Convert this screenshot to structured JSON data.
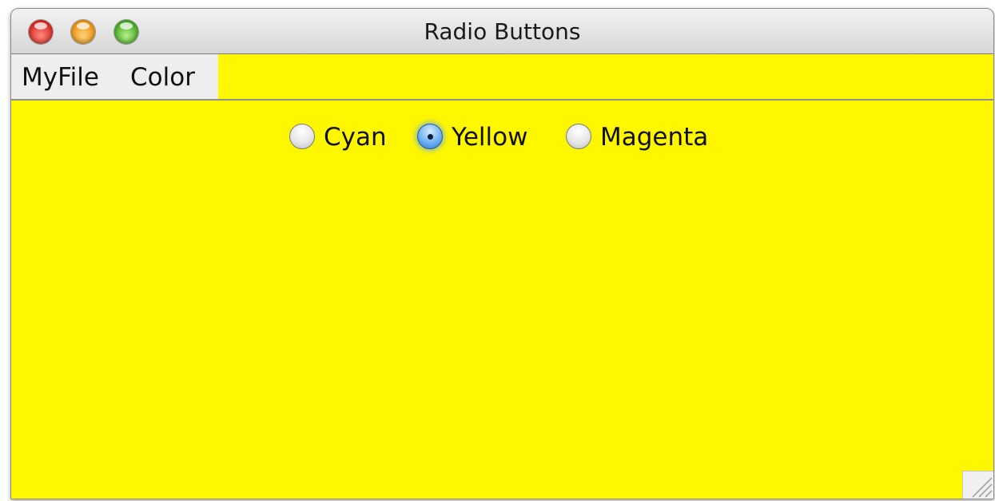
{
  "window": {
    "title": "Radio Buttons",
    "background_color": "#fff700"
  },
  "titlebar_buttons": [
    "close",
    "minimize",
    "zoom"
  ],
  "menubar": {
    "items": [
      {
        "label": "MyFile"
      },
      {
        "label": "Color"
      }
    ]
  },
  "radio_group": {
    "options": [
      {
        "label": "Cyan",
        "checked": false
      },
      {
        "label": "Yellow",
        "checked": true
      },
      {
        "label": "Magenta",
        "checked": false
      }
    ],
    "selected": "Yellow"
  }
}
